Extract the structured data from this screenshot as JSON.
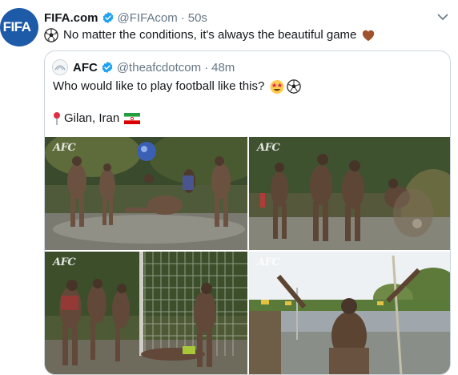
{
  "tweet": {
    "author_name": "FIFA.com",
    "author_handle": "@FIFAcom",
    "separator": "·",
    "time": "50s",
    "avatar_text": "FIFA",
    "text": "No matter the conditions, it's always the beautiful game",
    "emoji_start": "soccer-ball",
    "emoji_end": "brown-heart"
  },
  "quoted": {
    "author_name": "AFC",
    "author_handle": "@theafcdotcom",
    "separator": "·",
    "time": "48m",
    "text": "Who would like to play football like this?",
    "emojis": [
      "star-struck-face",
      "soccer-ball"
    ],
    "location": "Gilan, Iran",
    "location_icon": "round-pushpin",
    "flag": "iran-flag"
  },
  "photos": [
    {
      "watermark": "AFC"
    },
    {
      "watermark": "AFC"
    },
    {
      "watermark": "AFC"
    },
    {
      "watermark": "AFC"
    }
  ],
  "colors": {
    "verified": "#1da1f2",
    "text": "#14171a",
    "secondary": "#657786",
    "border": "#ccd6dd"
  }
}
